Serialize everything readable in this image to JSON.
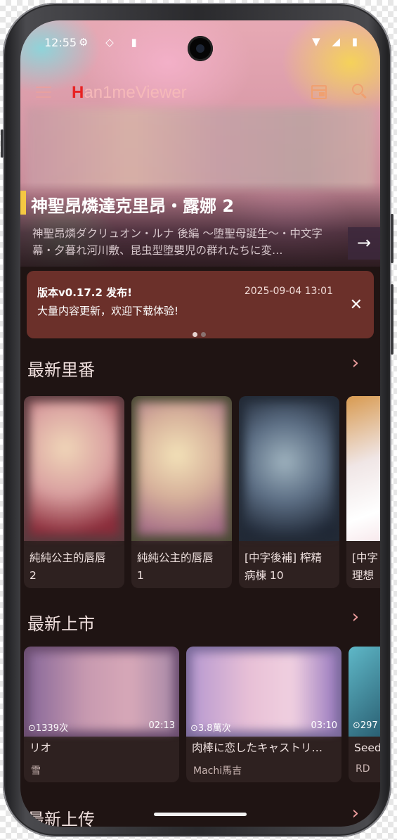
{
  "status_bar": {
    "time": "12:55",
    "left_icons": "⚙ ◇ ▮",
    "right_icons": "▼ ◢ ▮"
  },
  "app": {
    "title_initial": "H",
    "title_rest": "an1meViewer"
  },
  "hero": {
    "title": "神聖昂燐達克里昂・露娜 2",
    "description": "神聖昂燐ダクリュオン・ルナ 後編 〜堕聖母誕生〜・中文字幕・夕暮れ河川敷、昆虫型堕嬰児の群れたちに変…",
    "arrow": "→"
  },
  "notice": {
    "title": "版本v0.17.2 发布!",
    "date": "2025-09-04 13:01",
    "body": "大量内容更新，欢迎下载体验!",
    "close": "✕"
  },
  "sections": [
    {
      "title": "最新里番",
      "arrow": "›",
      "cards": [
        {
          "title": "純純公主的唇唇\n2"
        },
        {
          "title": "純純公主的唇唇\n1"
        },
        {
          "title": "[中字後補] 榨精\n病棟 10"
        },
        {
          "title": "[中字\n理想"
        }
      ]
    },
    {
      "title": "最新上市",
      "arrow": "›",
      "cards": [
        {
          "views": "⊙1339次",
          "duration": "02:13",
          "title": "リオ",
          "author": "雪"
        },
        {
          "views": "⊙3.8萬次",
          "duration": "03:10",
          "title": "肉棒に恋したキャストリ…",
          "author": "Machi馬吉"
        },
        {
          "views": "⊙297",
          "duration": "",
          "title": "Seed",
          "author": "RD"
        }
      ]
    },
    {
      "title": "最新上传",
      "arrow": "›"
    }
  ],
  "colors": {
    "background": "#1f1413",
    "notice": "#6b302a",
    "accent": "#f0a070",
    "title_red": "#e82222"
  }
}
